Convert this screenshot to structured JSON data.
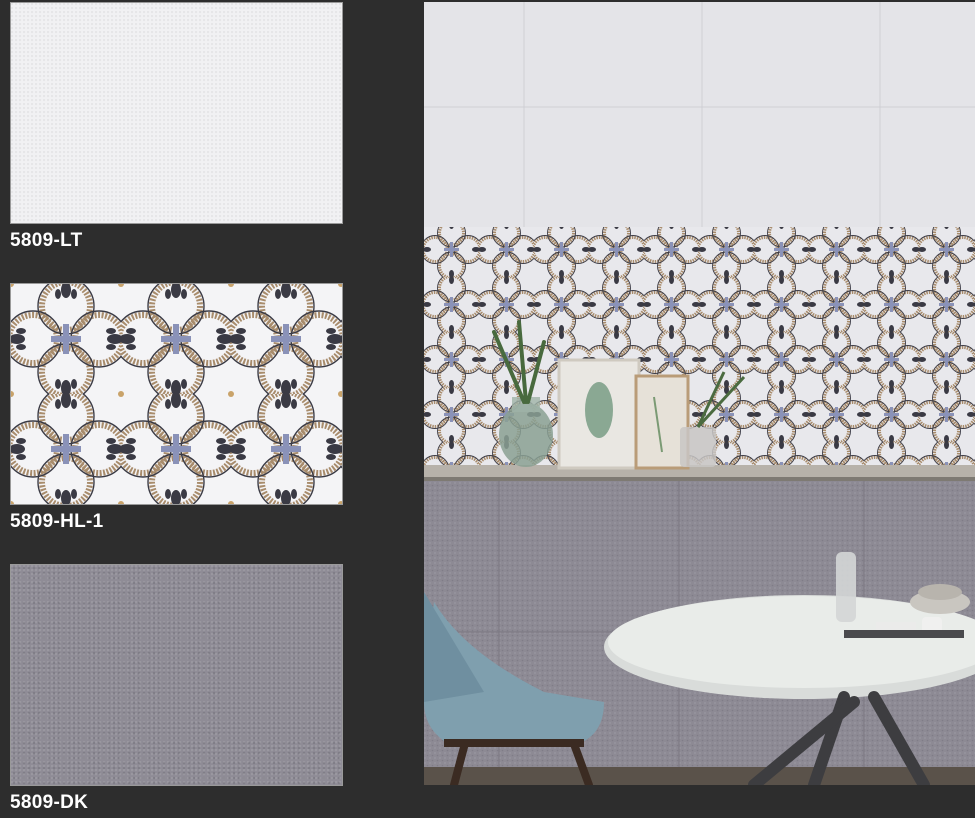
{
  "tiles": [
    {
      "code": "5809-LT",
      "variant": "light"
    },
    {
      "code": "5809-HL-1",
      "variant": "pattern"
    },
    {
      "code": "5809-DK",
      "variant": "dark"
    }
  ],
  "colors": {
    "background": "#2d2d2d",
    "tile_light": "#f1f1f3",
    "tile_dark": "#8f8c96",
    "pattern_ink": "#3a3a44",
    "pattern_border": "#a88c6c",
    "pattern_accent": "#8a92b8"
  },
  "room_scene": {
    "description_icon": "room-preview-image"
  }
}
